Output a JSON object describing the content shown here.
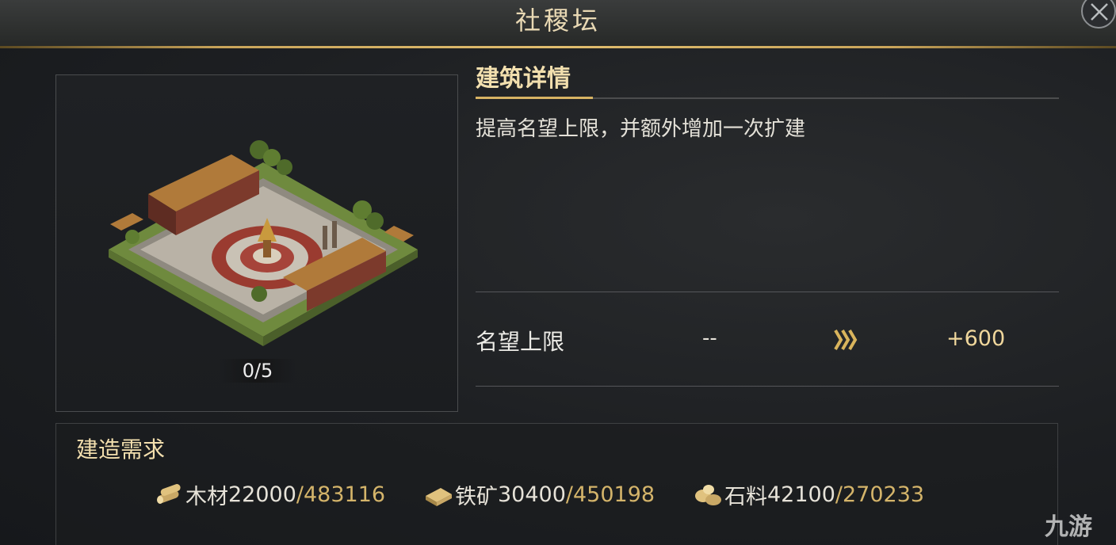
{
  "window": {
    "title": "社稷坛"
  },
  "building": {
    "level": "0/5"
  },
  "detail": {
    "section_title": "建筑详情",
    "description": "提高名望上限，并额外增加一次扩建",
    "stat": {
      "label": "名望上限",
      "current": "--",
      "next": "+600"
    }
  },
  "requirements": {
    "title": "建造需求",
    "items": [
      {
        "icon": "wood-icon",
        "name": "木材",
        "required": "22000",
        "owned": "/483116"
      },
      {
        "icon": "iron-ore-icon",
        "name": "铁矿",
        "required": "30400",
        "owned": "/450198"
      },
      {
        "icon": "stone-icon",
        "name": "石料",
        "required": "42100",
        "owned": "/270233"
      }
    ]
  },
  "watermark": "九游",
  "colors": {
    "accent_gold": "#d7b363",
    "owned_text": "#d4b46a",
    "heading_text": "#f2dfae"
  }
}
